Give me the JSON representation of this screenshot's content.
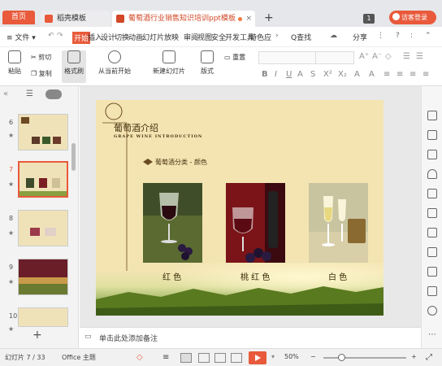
{
  "tabs": {
    "home": "首页",
    "docer": "稻壳模板",
    "document": "葡萄酒行业销售知识培训ppt模板",
    "close": "×",
    "add": "+",
    "window_count": "1",
    "visitor": "访客登录"
  },
  "menu": {
    "file": "≡ 文件 ▾",
    "items": [
      "开始",
      "插入",
      "设计",
      "切换",
      "动画",
      "幻灯片放映",
      "审阅",
      "视图",
      "安全",
      "开发工具",
      "特色应"
    ],
    "more": "›",
    "search": "Q查找",
    "share": "分享",
    "help": "?"
  },
  "ribbon": {
    "paste": "粘贴",
    "cut": "剪切",
    "copy": "复制",
    "format_painter": "格式刷",
    "from_current": "从当前开始",
    "new_slide": "新建幻灯片",
    "layout": "版式",
    "reset": "重置"
  },
  "thumbnails": [
    {
      "num": "6",
      "selected": false
    },
    {
      "num": "7",
      "selected": true
    },
    {
      "num": "8",
      "selected": false
    },
    {
      "num": "9",
      "selected": false
    },
    {
      "num": "10",
      "selected": false
    }
  ],
  "slide": {
    "title": "葡萄酒介绍",
    "subtitle": "GRAPE WINE INTRODUCTION",
    "section": "葡萄酒分类 - 颜色",
    "captions": [
      "红 色",
      "桃 红 色",
      "白 色"
    ]
  },
  "notes": {
    "placeholder": "单击此处添加备注"
  },
  "status": {
    "slide_info": "幻灯片 7 / 33",
    "theme": "Office 主题",
    "zoom": "50%",
    "zoom_out": "−",
    "zoom_in": "+"
  },
  "colors": {
    "accent": "#e85a3b",
    "slide_bg": "#f3e4b2",
    "slide_text": "#5a3c12"
  }
}
